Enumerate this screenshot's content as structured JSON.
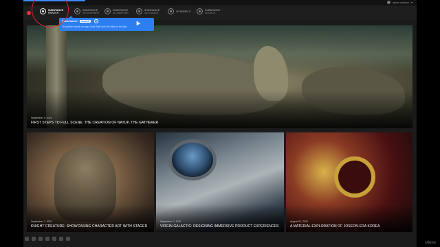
{
  "header": {
    "user_name": "steve wallace"
  },
  "nav": {
    "items": [
      {
        "line1": "SUBSTANCE",
        "line2": "PAINTER",
        "active": true,
        "icon": "substance-painter-icon"
      },
      {
        "line1": "SUBSTANCE",
        "line2": "3D DESIGNER",
        "active": false,
        "icon": "substance-designer-icon"
      },
      {
        "line1": "SUBSTANCE",
        "line2": "3D SAMPLER",
        "active": false,
        "icon": "substance-sampler-icon"
      },
      {
        "line1": "SUBSTANCE",
        "line2": "3D STAGER",
        "active": false,
        "icon": "substance-stager-icon"
      },
      {
        "line1": "3D MODELS",
        "line2": "",
        "active": false,
        "icon": "3d-models-icon"
      },
      {
        "line1": "SUBSTANCE",
        "line2": "SOURCE",
        "active": false,
        "icon": "substance-source-icon"
      }
    ]
  },
  "tooltip": {
    "title": "Quick launch",
    "button": "Launch",
    "body": "To quickly launch an app, hold Shift and left click on the tab."
  },
  "hero": {
    "date": "September 9, 2021",
    "title": "FIRST STEPS TO FULL SCENE: THE CREATION OF NATUP, THE GATHERER"
  },
  "cards": [
    {
      "date": "September 7, 2021",
      "title": "KNIGHT CREATURE: SHOWCASING CHARACTER ART WITH STAGER"
    },
    {
      "date": "September 2, 2021",
      "title": "VIRGIN GALACTIC: DESIGNING IMMERSIVE PRODUCT EXPERIENCES"
    },
    {
      "date": "August 31, 2021",
      "title": "A MATERIAL EXPLORATION OF JOSEON-ERA KOREA"
    }
  ],
  "watermark": "Udemy",
  "colors": {
    "accent": "#2d7ff1",
    "annotation_red": "#d8262d",
    "brand_red": "#e2343b"
  }
}
